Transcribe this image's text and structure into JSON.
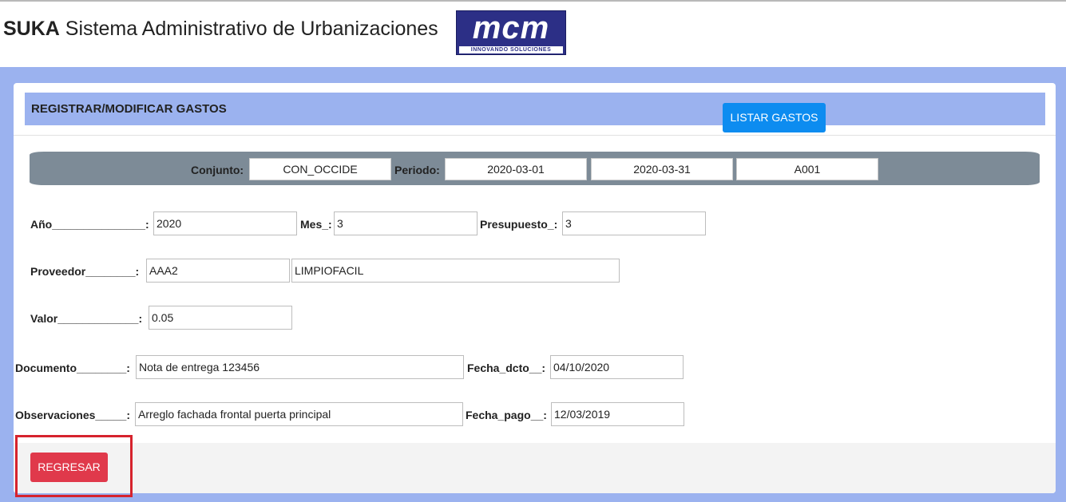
{
  "app": {
    "brand": "SUKA",
    "title": "Sistema Administrativo de Urbanizaciones",
    "logo": {
      "mark": "mcm",
      "tagline": "INNOVANDO SOLUCIONES"
    }
  },
  "card": {
    "title": "REGISTRAR/MODIFICAR GASTOS",
    "list_button": "LISTAR GASTOS"
  },
  "context": {
    "conjunto_label": "Conjunto:",
    "conjunto_value": "CON_OCCIDE",
    "periodo_label": "Periodo:",
    "periodo_start": "2020-03-01",
    "periodo_end": "2020-03-31",
    "codigo": "A001"
  },
  "form": {
    "anio_label": "Año_______________:",
    "anio_value": "2020",
    "mes_label": "Mes_:",
    "mes_value": "3",
    "presupuesto_label": "Presupuesto_:",
    "presupuesto_value": "3",
    "proveedor_label": "Proveedor________:",
    "proveedor_code": "AAA2",
    "proveedor_name": "LIMPIOFACIL",
    "valor_label": "Valor_____________:",
    "valor_value": "0.05",
    "documento_label": "Documento________:",
    "documento_value": "Nota de entrega 123456",
    "fecha_dcto_label": "Fecha_dcto__:",
    "fecha_dcto_value": "04/10/2020",
    "observaciones_label": "Observaciones_____:",
    "observaciones_value": "Arreglo fachada frontal puerta principal",
    "fecha_pago_label": "Fecha_pago__:",
    "fecha_pago_value": "12/03/2019"
  },
  "actions": {
    "back_button": "REGRESAR"
  },
  "colors": {
    "page_band": "#9bb2ef",
    "primary_button": "#0d8cf0",
    "danger_button": "#e0394b",
    "highlight": "#d6232d",
    "context_bar": "#7d8b97",
    "logo_bg": "#2c2f86"
  }
}
